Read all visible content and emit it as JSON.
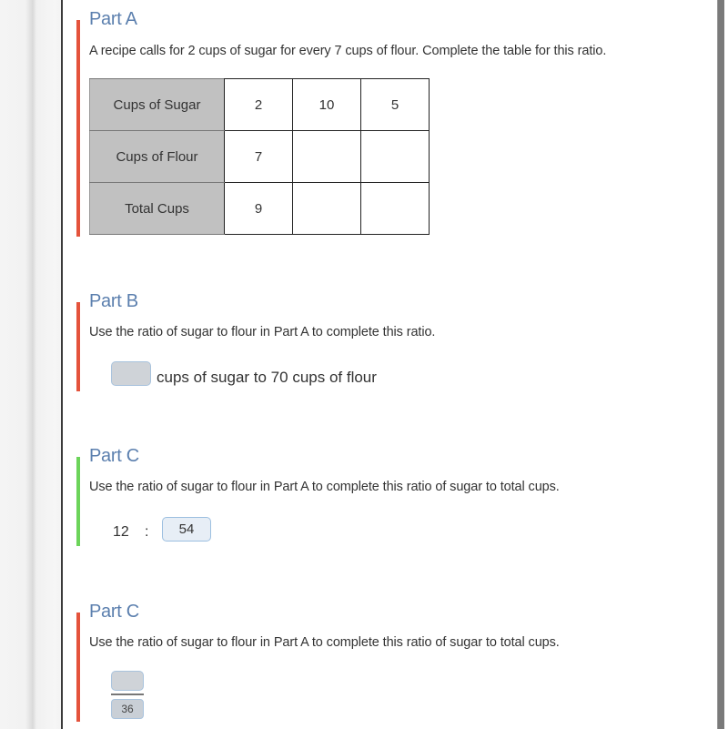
{
  "colors": {
    "title": "#5b7fae",
    "incorrect": "#e4533c",
    "correct": "#6cd45a",
    "table_header_bg": "#c1c1c1",
    "answer_box_empty": "#cfd3d8",
    "answer_box_filled": "#e7eef6"
  },
  "partA": {
    "title": "Part A",
    "status": "incorrect",
    "prompt": "A recipe calls for 2 cups of sugar for every 7 cups of flour. Complete the table for this ratio.",
    "table": {
      "rows": [
        {
          "header": "Cups of Sugar",
          "cells": [
            "2",
            "10",
            "5"
          ]
        },
        {
          "header": "Cups of Flour",
          "cells": [
            "7",
            "",
            ""
          ]
        },
        {
          "header": "Total Cups",
          "cells": [
            "9",
            "",
            ""
          ]
        }
      ]
    }
  },
  "partB": {
    "title": "Part B",
    "status": "incorrect",
    "prompt": "Use the ratio of sugar to flour in Part A to complete this ratio.",
    "answer_value": "",
    "suffix_text": "cups of sugar to 70 cups of flour"
  },
  "partC1": {
    "title": "Part C",
    "status": "correct",
    "prompt": "Use the ratio of sugar to flour in Part A to complete this ratio of sugar to total cups.",
    "left_value": "12",
    "separator": ":",
    "answer_value": "54"
  },
  "partC2": {
    "title": "Part C",
    "status": "incorrect",
    "prompt": "Use the ratio of sugar to flour in Part A to complete this ratio of sugar to total cups.",
    "numerator_value": "",
    "denominator_value": "36"
  }
}
